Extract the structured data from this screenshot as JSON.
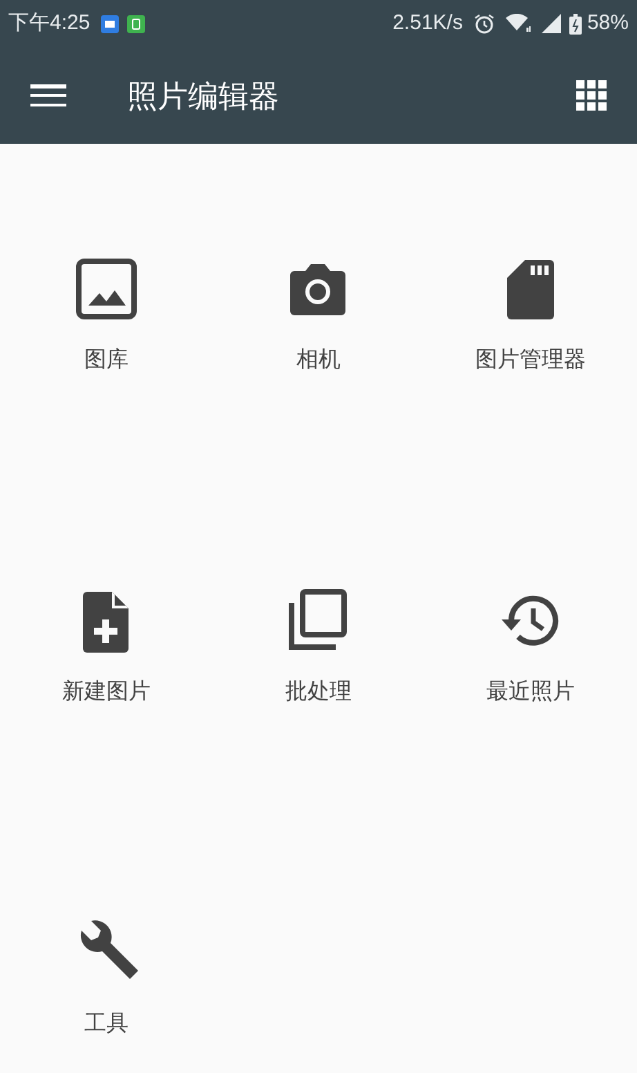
{
  "status_bar": {
    "time": "下午4:25",
    "speed": "2.51K/s",
    "battery": "58%"
  },
  "app_bar": {
    "title": "照片编辑器"
  },
  "items": [
    {
      "kind": "gallery",
      "label": "图库"
    },
    {
      "kind": "camera",
      "label": "相机"
    },
    {
      "kind": "sdcard",
      "label": "图片管理器"
    },
    {
      "kind": "newfile",
      "label": "新建图片"
    },
    {
      "kind": "batch",
      "label": "批处理"
    },
    {
      "kind": "history",
      "label": "最近照片"
    },
    {
      "kind": "wrench",
      "label": "工具"
    }
  ]
}
